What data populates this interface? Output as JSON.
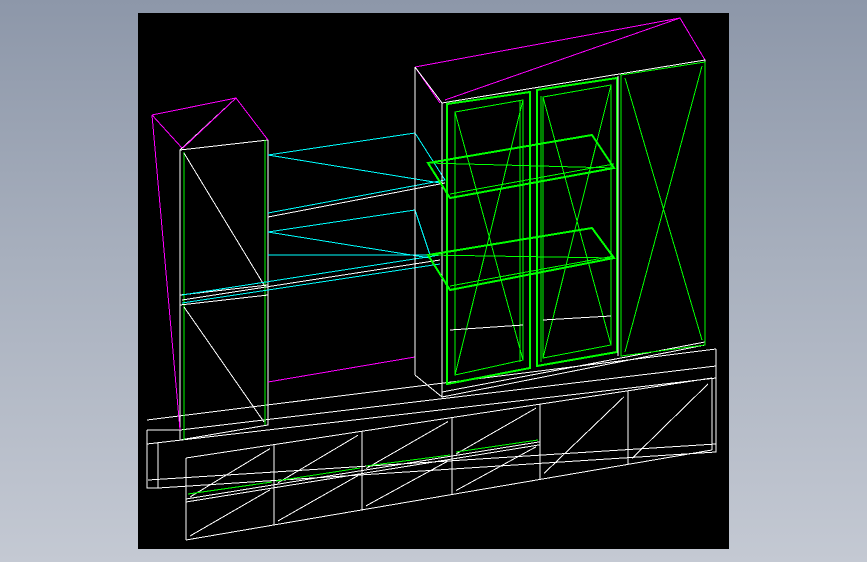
{
  "viewport": {
    "background": "#000000"
  },
  "palette": {
    "outline": "#ffffff",
    "hidden": "#ff00ff",
    "glass": "#00ff00",
    "shelf": "#00ffff",
    "page_top": "#8d97a9",
    "page_bottom": "#c4c9d3"
  },
  "drawing": {
    "subject": "wall-unit-cabinet-wireframe"
  }
}
